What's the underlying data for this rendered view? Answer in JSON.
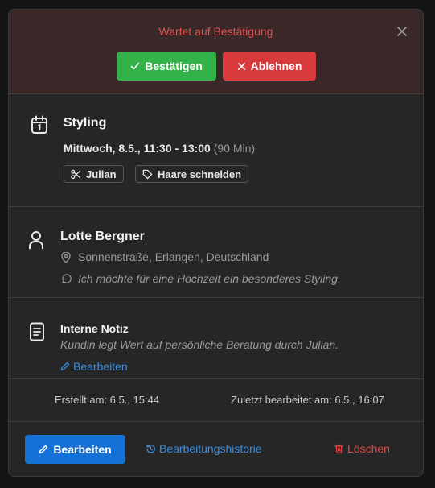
{
  "header": {
    "status": "Wartet auf Bestätigung",
    "confirm_label": "Bestätigen",
    "reject_label": "Ablehnen"
  },
  "appointment": {
    "service": "Styling",
    "datetime": "Mittwoch, 8.5., 11:30 - 13:00",
    "duration": "(90 Min)",
    "staff": "Julian",
    "treatment": "Haare schneiden"
  },
  "customer": {
    "name": "Lotte Bergner",
    "address": "Sonnenstraße, Erlangen, Deutschland",
    "comment": "Ich möchte für eine Hochzeit ein besonderes Styling."
  },
  "note": {
    "title": "Interne Notiz",
    "text": "Kundin legt Wert auf persönliche Beratung durch Julian.",
    "edit_label": "Bearbeiten"
  },
  "meta": {
    "created": "Erstellt am: 6.5., 15:44",
    "updated": "Zuletzt bearbeitet am: 6.5., 16:07"
  },
  "footer": {
    "edit_label": "Bearbeiten",
    "history_label": "Bearbeitungshistorie",
    "delete_label": "Löschen"
  },
  "colors": {
    "confirm": "#33b24a",
    "reject": "#d83b3b",
    "primary": "#1472d6",
    "link": "#3a8fe0",
    "danger": "#e04848",
    "status": "#e05050"
  }
}
